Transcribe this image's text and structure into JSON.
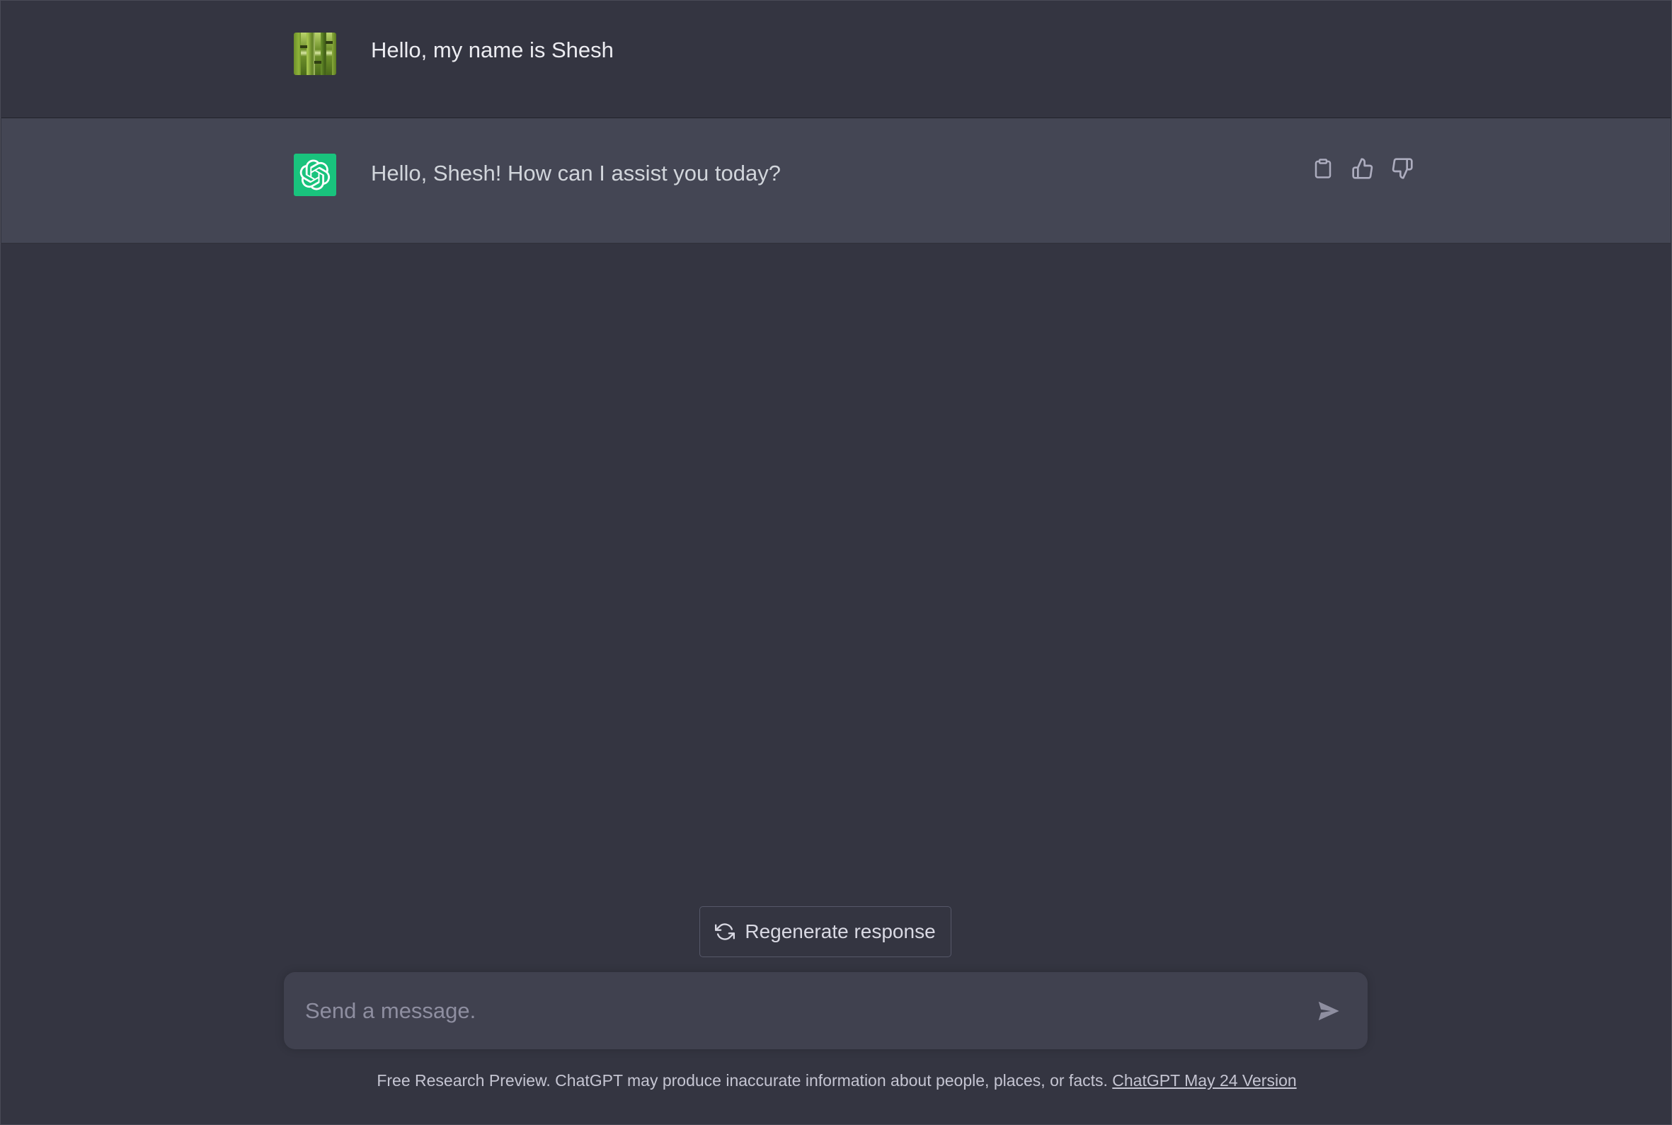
{
  "conversation": {
    "user_message": {
      "avatar": "user-avatar-bamboo-photo",
      "text": "Hello, my name is Shesh"
    },
    "assistant_message": {
      "avatar": "openai-logo-icon",
      "text": "Hello, Shesh! How can I assist you today?",
      "actions": [
        "clipboard-icon",
        "thumbs-up-icon",
        "thumbs-down-icon"
      ]
    }
  },
  "regenerate": {
    "icon": "refresh-icon",
    "label": "Regenerate response"
  },
  "composer": {
    "placeholder": "Send a message.",
    "value": "",
    "send_icon": "send-icon"
  },
  "footer": {
    "text": "Free Research Preview. ChatGPT may produce inaccurate information about people, places, or facts. ",
    "link_label": "ChatGPT May 24 Version"
  },
  "colors": {
    "background": "#343541",
    "assistant_row": "#444654",
    "composer": "#40414f",
    "brand_green": "#19c37d",
    "text": "#ececf1"
  }
}
